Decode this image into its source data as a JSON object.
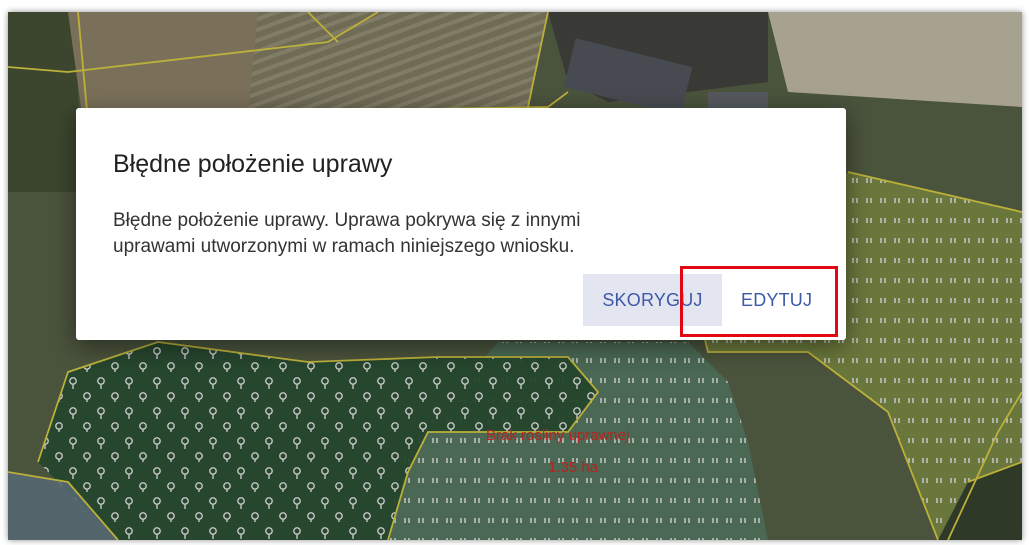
{
  "dialog": {
    "title": "Błędne położenie uprawy",
    "message_line1": "Błędne położenie uprawy. Uprawa pokrywa się z innymi",
    "message_line2": "uprawami utworzonymi w ramach niniejszego wniosku.",
    "buttons": {
      "correct": "SKORYGUJ",
      "edit": "EDYTUJ"
    }
  },
  "map": {
    "parcel_label_name": "Brak rośliny uprawnej",
    "parcel_label_area": "1.35 ha"
  },
  "colors": {
    "accent_button_text": "#3d59a8",
    "highlight_border": "#e30613",
    "parcel_label": "#b3261e",
    "parcel_outline": "#f0e24a"
  }
}
